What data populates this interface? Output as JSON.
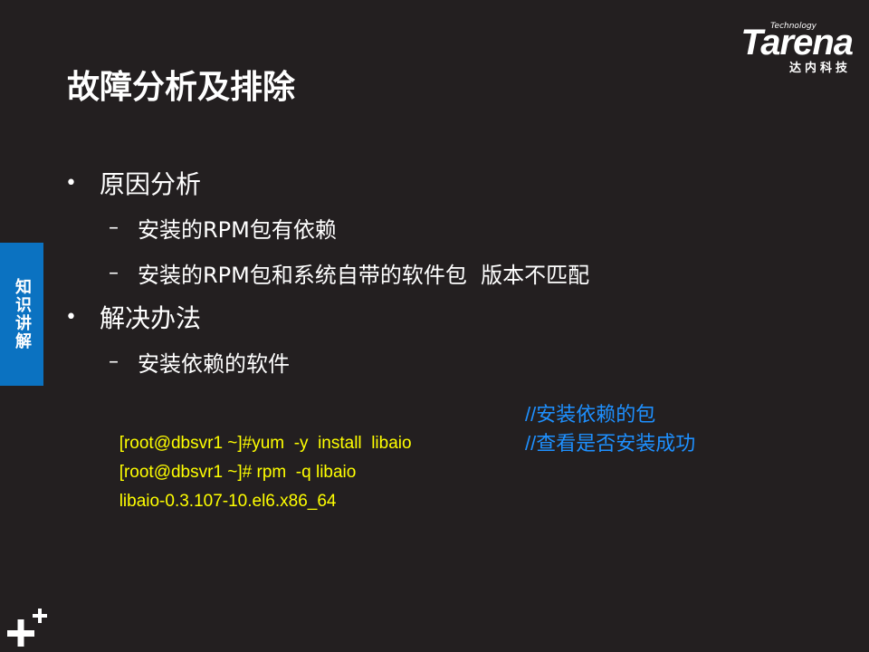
{
  "logo": {
    "technology": "Technology",
    "brand": "Tarena",
    "subtitle": "达内科技"
  },
  "title": "故障分析及排除",
  "side_tab": "知识讲解",
  "sections": [
    {
      "heading": "原因分析",
      "items": [
        "安装的RPM包有依赖",
        "安装的RPM包和系统自带的软件包  版本不匹配"
      ]
    },
    {
      "heading": "解决办法",
      "items": [
        "安装依赖的软件"
      ]
    }
  ],
  "code": [
    {
      "cmd": "[root@dbsvr1 ~]#yum  -y  install  libaio",
      "comment": "//安装依赖的包"
    },
    {
      "cmd": "[root@dbsvr1 ~]# rpm  -q libaio",
      "comment": "//查看是否安装成功"
    },
    {
      "cmd": "libaio-0.3.107-10.el6.x86_64",
      "comment": ""
    }
  ],
  "colors": {
    "background": "#231f20",
    "command": "#ffff00",
    "comment": "#1e90ff",
    "side_tab": "#0b72c1"
  },
  "icons": [
    "plus-plus-icon"
  ]
}
